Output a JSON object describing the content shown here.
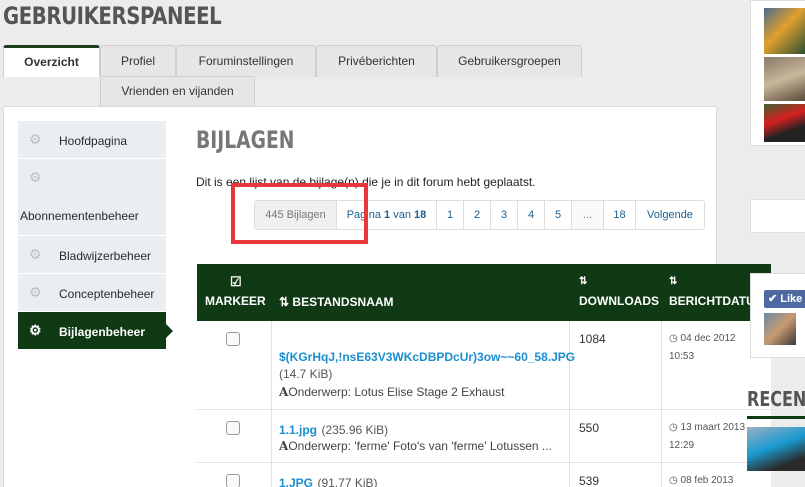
{
  "header": {
    "title": "GEBRUIKERSPANEEL"
  },
  "tabs": [
    {
      "label": "Overzicht",
      "active": true
    },
    {
      "label": "Profiel"
    },
    {
      "label": "Foruminstellingen"
    },
    {
      "label": "Privéberichten"
    },
    {
      "label": "Gebruikersgroepen"
    },
    {
      "label": "Vrienden en vijanden"
    }
  ],
  "sidebar": {
    "items": [
      {
        "label": "Hoofdpagina",
        "icon": "gear-icon"
      },
      {
        "label": "Abonnementenbeheer",
        "icon": "gear-icon"
      },
      {
        "label": "Bladwijzerbeheer",
        "icon": "gear-icon"
      },
      {
        "label": "Conceptenbeheer",
        "icon": "gear-icon"
      },
      {
        "label": "Bijlagenbeheer",
        "icon": "gear-icon",
        "active": true
      }
    ]
  },
  "main": {
    "title": "BIJLAGEN",
    "intro": "Dit is een lijst van de bijlage(n) die je in dit forum hebt geplaatst."
  },
  "pager": {
    "count": "445 Bijlagen",
    "page_prefix": "Pagina",
    "page_current": "1",
    "page_mid": "van",
    "page_total": "18",
    "pages": [
      "1",
      "2",
      "3",
      "4",
      "5"
    ],
    "ellipsis": "...",
    "last": "18",
    "next": "Volgende"
  },
  "table": {
    "headers": {
      "mark": "MARKEER",
      "name": "BESTANDSNAAM",
      "downloads": "DOWNLOADS",
      "date": "BERICHTDATUM"
    },
    "sort_glyph": "↓",
    "sort_az": "Z A",
    "rows": [
      {
        "filename": "$(KGrHqJ,!nsE63V3WKcDBPDcUr)3ow~~60_58.JPG",
        "size": "(14.7 KiB)",
        "subject_prefix": "Onderwerp:",
        "subject": "Lotus Elise Stage 2 Exhaust",
        "downloads": "1084",
        "date": "04 dec 2012",
        "time": "10:53"
      },
      {
        "filename": "1.1.jpg",
        "size": "(235.96 KiB)",
        "subject_prefix": "Onderwerp:",
        "subject": "'ferme' Foto's van 'ferme' Lotussen ...",
        "downloads": "550",
        "date": "13 maart 2013",
        "time": "12:29"
      },
      {
        "filename": "1.JPG",
        "size": "(91.77 KiB)",
        "subject_prefix": "",
        "subject": "",
        "downloads": "539",
        "date": "08 feb 2013",
        "time": ""
      }
    ]
  },
  "right": {
    "like": "Like",
    "recent": "RECENT"
  },
  "colors": {
    "brand_dark_green": "#0f3a14",
    "link_blue": "#1a8ed0",
    "highlight_red": "#e8373b"
  }
}
